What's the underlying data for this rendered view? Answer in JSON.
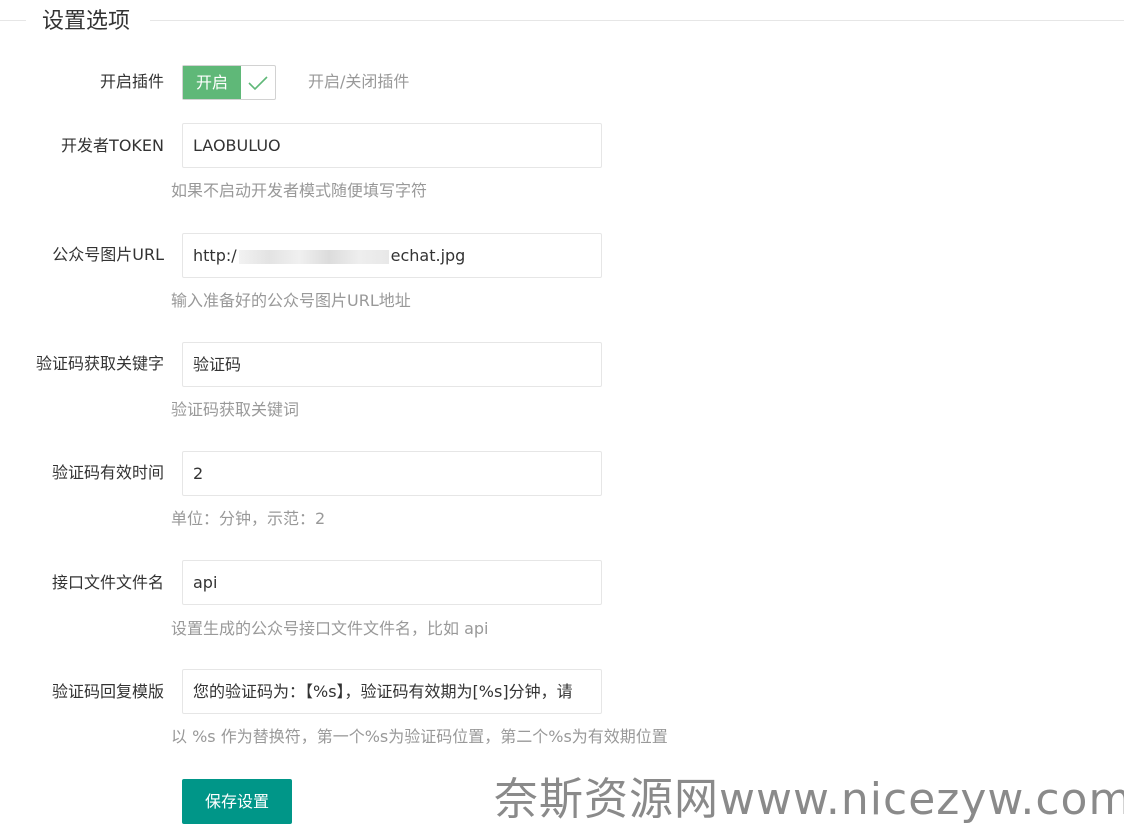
{
  "section": {
    "legend": "设置选项"
  },
  "plugin_switch": {
    "label": "开启插件",
    "state_text": "开启",
    "hint": "开启/关闭插件",
    "checked": true,
    "accent_color": "#5fb878"
  },
  "fields": [
    {
      "label": "开发者TOKEN",
      "value": "LAOBULUO",
      "hint": "如果不启动开发者模式随便填写字符"
    },
    {
      "label": "公众号图片URL",
      "value_prefix": "http:/",
      "value_suffix": "echat.jpg",
      "hint": "输入准备好的公众号图片URL地址"
    },
    {
      "label": "验证码获取关键字",
      "value": "验证码",
      "hint": "验证码获取关键词"
    },
    {
      "label": "验证码有效时间",
      "value": "2",
      "hint": "单位：分钟，示范：2"
    },
    {
      "label": "接口文件文件名",
      "value": "api",
      "hint": "设置生成的公众号接口文件文件名，比如 api"
    },
    {
      "label": "验证码回复模版",
      "value": "您的验证码为：【%s】，验证码有效期为[%s]分钟，请",
      "hint": "以 %s 作为替换符，第一个%s为验证码位置，第二个%s为有效期位置"
    }
  ],
  "actions": {
    "save_label": "保存设置",
    "save_color": "#009688"
  },
  "watermark": {
    "text": "奈斯资源网www.nicezyw.com"
  }
}
